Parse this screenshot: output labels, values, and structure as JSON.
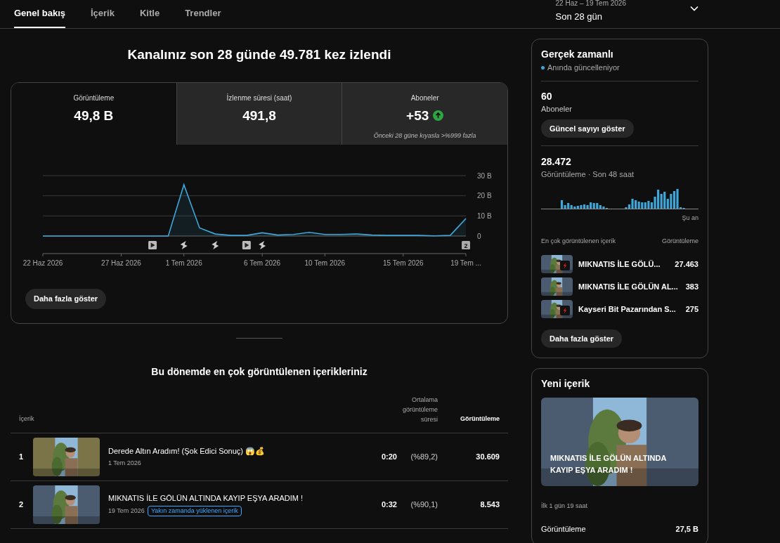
{
  "tabs": [
    {
      "label": "Genel bakış",
      "selected": true
    },
    {
      "label": "İçerik",
      "selected": false
    },
    {
      "label": "Kitle",
      "selected": false
    },
    {
      "label": "Trendler",
      "selected": false
    }
  ],
  "date_range": {
    "range": "22 Haz – 19 Tem 2026",
    "label": "Son 28 gün"
  },
  "headline": "Kanalınız son 28 günde 49.781 kez izlendi",
  "metrics": [
    {
      "label": "Görüntüleme",
      "value": "49,8 B",
      "selected": true
    },
    {
      "label": "İzlenme süresi (saat)",
      "value": "491,8",
      "selected": false
    },
    {
      "label": "Aboneler",
      "value": "+53",
      "selected": false,
      "rising": true,
      "note": "Önceki 28 güne kıyasla >%999 fazla"
    }
  ],
  "chart": {
    "chart_data": {
      "type": "area",
      "categories": [
        "22 Haz 2026",
        null,
        null,
        null,
        null,
        "27 Haz 2026",
        null,
        null,
        null,
        "1 Tem 2026",
        null,
        null,
        null,
        null,
        "6 Tem 2026",
        null,
        null,
        null,
        "10 Tem 2026",
        null,
        null,
        null,
        null,
        "15 Tem 2026",
        null,
        null,
        null,
        "19 Tem ..."
      ],
      "series": [
        {
          "color": "#3ea6d8",
          "values": [
            0,
            0,
            0,
            0,
            0,
            0,
            0,
            0,
            0,
            25.5,
            4,
            1,
            0.3,
            0.3,
            1.6,
            0.5,
            0.8,
            1.8,
            0.8,
            0.8,
            1,
            0.5,
            0.3,
            0.3,
            0.3,
            0.1,
            0.3,
            8.7
          ]
        }
      ],
      "ylim": [
        0,
        30
      ],
      "yticks": [
        {
          "value": 0,
          "label": "0"
        },
        {
          "value": 10,
          "label": "10 B"
        },
        {
          "value": 20,
          "label": "20 B"
        },
        {
          "value": 30,
          "label": "30 B"
        }
      ]
    },
    "markers": [
      {
        "kind": "video"
      },
      {
        "kind": "short"
      },
      {
        "kind": "short"
      },
      {
        "kind": "video"
      },
      {
        "kind": "short"
      },
      {
        "kind": "count",
        "text": "2"
      }
    ],
    "more": "Daha fazla göster"
  },
  "top_content": {
    "title": "Bu dönemde en çok görüntülenen içerikleriniz",
    "columns": [
      "İçerik",
      "Ortalama görüntüleme süresi",
      "Görüntüleme"
    ],
    "rows": [
      {
        "rank": "1",
        "title": "Derede Altın Aradım! (Şok Edici Sonuç) 😱💰",
        "date": "1 Tem 2026",
        "avg": "0:20",
        "pct": "(%89,2)",
        "views": "30.609"
      },
      {
        "rank": "2",
        "title": "MIKNATIS İLE GÖLÜN ALTINDA KAYIP EŞYA ARADIM !",
        "date": "19 Tem 2026",
        "badge": "Yakın zamanda yüklenen içerik",
        "avg": "0:32",
        "pct": "(%90,1)",
        "views": "8.543"
      }
    ]
  },
  "realtime": {
    "title": "Gerçek zamanlı",
    "status": "Anında güncelleniyor",
    "subs_value": "60",
    "subs_label": "Aboneler",
    "subs_button": "Güncel sayıyı göster",
    "views_value": "28.472",
    "views_label": "Görüntüleme · Son 48 saat",
    "now_label": "Şu an",
    "list_header": "En çok görüntülenen içerik",
    "list_header_right": "Görüntüleme",
    "items": [
      {
        "title": "MIKNATIS İLE GÖLÜ...",
        "views": "27.463",
        "short": true
      },
      {
        "title": "MIKNATIS İLE GÖLÜN AL...",
        "views": "383",
        "short": false
      },
      {
        "title": "Kayseri Bit Pazarından S...",
        "views": "275",
        "short": true
      }
    ],
    "more": "Daha fazla göster"
  },
  "new_content": {
    "title": "Yeni içerik",
    "video_title": "MIKNATIS İLE GÖLÜN ALTINDA KAYIP EŞYA ARADIM !",
    "period": "İlk 1 gün 19 saat",
    "stat_label": "Görüntüleme",
    "stat_value": "27,5 B"
  }
}
